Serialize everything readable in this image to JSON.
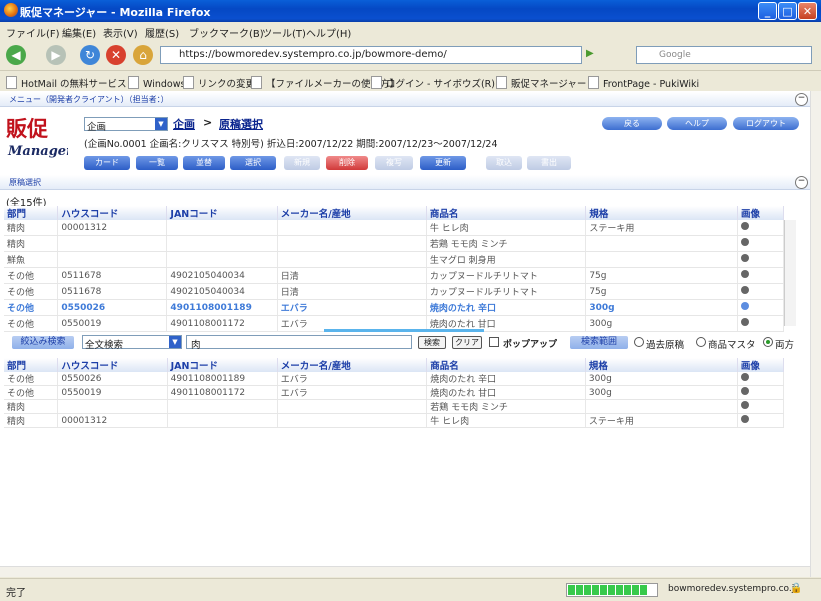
{
  "window": {
    "title": "販促マネージャー - Mozilla Firefox"
  },
  "menu": [
    "ファイル(F)",
    "編集(E)",
    "表示(V)",
    "履歴(S)",
    "ブックマーク(B)",
    "ツール(T)",
    "ヘルプ(H)"
  ],
  "url": "https://bowmoredev.systempro.co.jp/bowmore-demo/",
  "search_placeholder": "Google",
  "bookmarks": [
    "HotMail の無料サービス",
    "Windows",
    "リンクの変更",
    "【ファイルメーカーの使い方】",
    "ログイン - サイボウズ(R) ...",
    "販促マネージャー",
    "FrontPage - PukiWiki"
  ],
  "app": {
    "menu_link": "メニュー（開発者クライアント）（担当者：）",
    "logo_top": "販促",
    "logo_bottom": "Manager",
    "plan_select": "企画",
    "crumb_plan": "企画",
    "crumb_sep": ">",
    "crumb_current": "原稿選択",
    "info": "(企画No.0001 企画名:クリスマス  特別号)  折込日:2007/12/22 期間:2007/12/23〜2007/12/24",
    "right_buttons": [
      "戻る",
      "ヘルプ",
      "ログアウト"
    ],
    "toolbar": [
      {
        "label": "カード",
        "state": "on"
      },
      {
        "label": "一覧",
        "state": "on"
      },
      {
        "label": "並替",
        "state": "on"
      },
      {
        "label": "選択",
        "state": "on"
      },
      {
        "label": "新規",
        "state": "off"
      },
      {
        "label": "削除",
        "state": "red"
      },
      {
        "label": "複写",
        "state": "off"
      },
      {
        "label": "更新",
        "state": "on"
      },
      {
        "label": "取込",
        "state": "off"
      },
      {
        "label": "書出",
        "state": "off"
      }
    ],
    "section_title": "原稿選択",
    "count": "(全15件)",
    "columns": [
      "部門",
      "ハウスコード",
      "JANコード",
      "メーカー名/産地",
      "商品名",
      "規格",
      "画像"
    ],
    "rows": [
      {
        "dept": "精肉",
        "house": "00001312",
        "jan": "",
        "maker": "",
        "name": "牛 ヒレ肉",
        "spec": "ステーキ用",
        "hl": false
      },
      {
        "dept": "精肉",
        "house": "",
        "jan": "",
        "maker": "",
        "name": "若鶏 モモ肉 ミンチ",
        "spec": "",
        "hl": false
      },
      {
        "dept": "鮮魚",
        "house": "",
        "jan": "",
        "maker": "",
        "name": "生マグロ 刺身用",
        "spec": "",
        "hl": false
      },
      {
        "dept": "その他",
        "house": "0511678",
        "jan": "4902105040034",
        "maker": "日清",
        "name": "カップヌードルチリトマト",
        "spec": "75g",
        "hl": false
      },
      {
        "dept": "その他",
        "house": "0511678",
        "jan": "4902105040034",
        "maker": "日清",
        "name": "カップヌードルチリトマト",
        "spec": "75g",
        "hl": false
      },
      {
        "dept": "その他",
        "house": "0550026",
        "jan": "4901108001189",
        "maker": "エバラ",
        "name": "焼肉のたれ 辛口",
        "spec": "300g",
        "hl": true
      },
      {
        "dept": "その他",
        "house": "0550019",
        "jan": "4901108001172",
        "maker": "エバラ",
        "name": "焼肉のたれ 甘口",
        "spec": "300g",
        "hl": false
      }
    ],
    "filter": {
      "label": "絞込み検索",
      "mode": "全文検索",
      "query": "肉",
      "search_btn": "検索",
      "clear_btn": "クリア",
      "popup_label": "ポップアップ",
      "range_label": "検索範囲",
      "options": [
        "過去原稿",
        "商品マスタ",
        "両方"
      ],
      "selected": "両方"
    },
    "results": [
      {
        "dept": "その他",
        "house": "0550026",
        "jan": "4901108001189",
        "maker": "エバラ",
        "name": "焼肉のたれ 辛口",
        "spec": "300g"
      },
      {
        "dept": "その他",
        "house": "0550019",
        "jan": "4901108001172",
        "maker": "エバラ",
        "name": "焼肉のたれ 甘口",
        "spec": "300g"
      },
      {
        "dept": "精肉",
        "house": "",
        "jan": "",
        "maker": "",
        "name": "若鶏 モモ肉 ミンチ",
        "spec": ""
      },
      {
        "dept": "精肉",
        "house": "00001312",
        "jan": "",
        "maker": "",
        "name": "牛 ヒレ肉",
        "spec": "ステーキ用"
      }
    ]
  },
  "status": {
    "text": "完了",
    "host": "bowmoredev.systempro.co.jp",
    "progress": 1.0
  }
}
